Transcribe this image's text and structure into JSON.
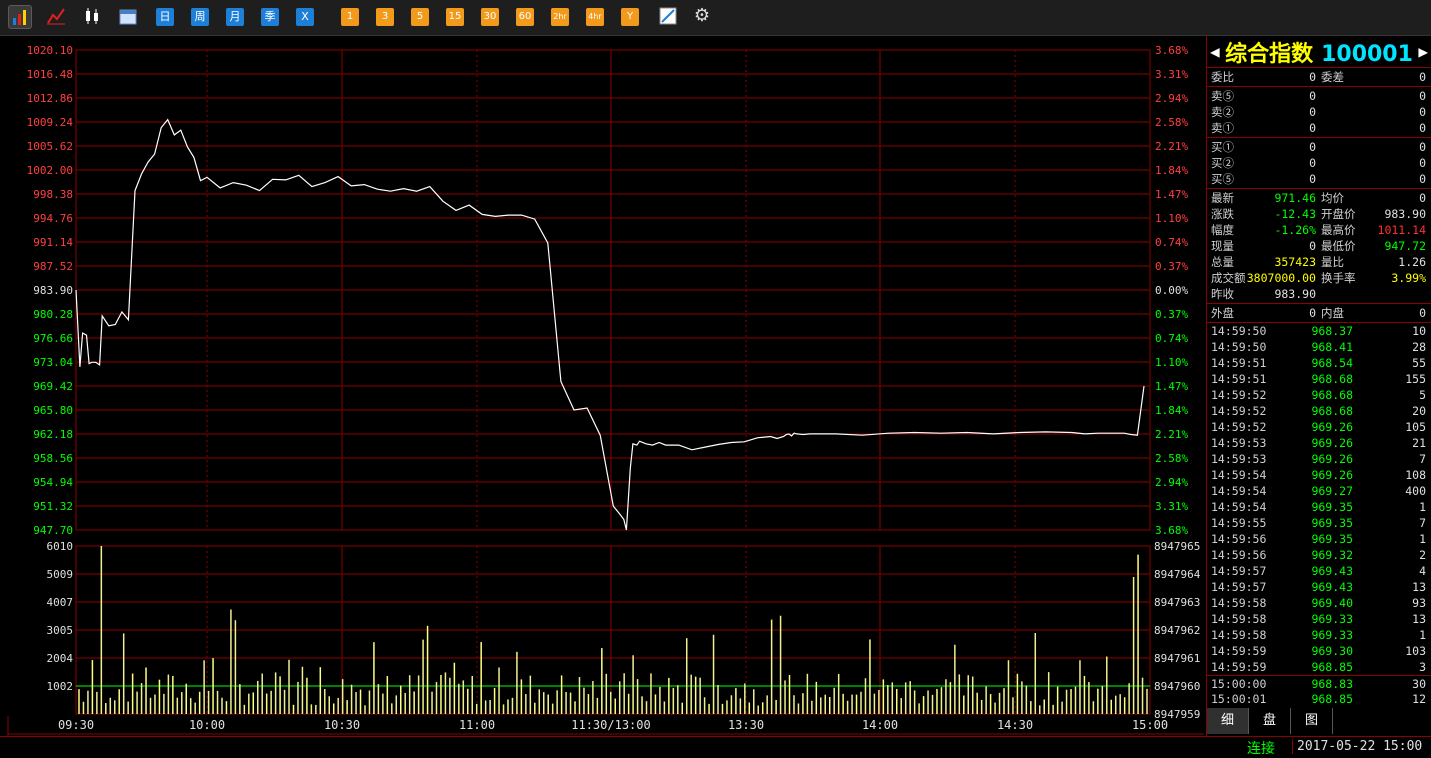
{
  "toolbar": {
    "icon_buttons": [
      "bar-chart-icon",
      "line-chart-icon",
      "candlestick-icon",
      "calendar-icon"
    ],
    "period_buttons": [
      "日",
      "周",
      "月",
      "季",
      "X"
    ],
    "interval_buttons": [
      "1",
      "3",
      "5",
      "15",
      "30",
      "60",
      "2hr",
      "4hr",
      "Y"
    ],
    "tool_icons": [
      "draw-line-icon",
      "gear-icon"
    ]
  },
  "chart_data": {
    "type": "line",
    "title": "",
    "price_ticks": [
      "1020.10",
      "1016.48",
      "1012.86",
      "1009.24",
      "1005.62",
      "1002.00",
      "998.38",
      "994.76",
      "991.14",
      "987.52",
      "983.90",
      "980.28",
      "976.66",
      "973.04",
      "969.42",
      "965.80",
      "962.18",
      "958.56",
      "954.94",
      "951.32",
      "947.70"
    ],
    "pct_ticks": [
      "3.68%",
      "3.31%",
      "2.94%",
      "2.58%",
      "2.21%",
      "1.84%",
      "1.47%",
      "1.10%",
      "0.74%",
      "0.37%",
      "0.00%",
      "0.37%",
      "0.74%",
      "1.10%",
      "1.47%",
      "1.84%",
      "2.21%",
      "2.58%",
      "2.94%",
      "3.31%",
      "3.68%"
    ],
    "ylim": [
      947.7,
      1020.1
    ],
    "prev_close": 983.9,
    "time_labels": [
      "09:30",
      "10:00",
      "10:30",
      "11:00",
      "11:30/13:00",
      "13:30",
      "14:00",
      "14:30",
      "15:00"
    ],
    "price_series": {
      "x": [
        0,
        3,
        5,
        8,
        10,
        12,
        15,
        18,
        20,
        25,
        30,
        35,
        40,
        45,
        50,
        55,
        60,
        65,
        70,
        75,
        80,
        85,
        90,
        95,
        100,
        110,
        120,
        130,
        140,
        150,
        160,
        170,
        180,
        190,
        200,
        210,
        220,
        230,
        240,
        250,
        260,
        270,
        280,
        290,
        300,
        310,
        320,
        330,
        340,
        350,
        360,
        370,
        380,
        390,
        400,
        410,
        415,
        418,
        420,
        423,
        425,
        428,
        430,
        435,
        440,
        445,
        450,
        460,
        470,
        480,
        490,
        500,
        510,
        520,
        530,
        535,
        540,
        542,
        544,
        546,
        548,
        550,
        555,
        560,
        570,
        580,
        600,
        620,
        640,
        660,
        680,
        700,
        720,
        740,
        760,
        770,
        780,
        795,
        800,
        805,
        810,
        815
      ],
      "y": [
        983.9,
        972.3,
        977.4,
        977.1,
        972.8,
        973.0,
        973.0,
        972.6,
        980.0,
        978.5,
        978.7,
        980.6,
        979.4,
        998.9,
        1001.4,
        1003.2,
        1004.4,
        1008.4,
        1009.6,
        1007.3,
        1008.0,
        1005.5,
        1003.9,
        1000.4,
        1000.9,
        999.3,
        1000.1,
        999.7,
        998.9,
        1000.6,
        1000.5,
        1001.2,
        999.5,
        1000.1,
        1001.0,
        999.6,
        999.8,
        999.1,
        998.8,
        999.2,
        998.8,
        999.5,
        997.3,
        995.9,
        996.7,
        995.3,
        995.0,
        995.2,
        995.2,
        994.6,
        991.0,
        970.1,
        965.8,
        966.1,
        962.0,
        951.3,
        950.1,
        949.3,
        947.7,
        957.0,
        960.7,
        960.5,
        961.1,
        960.7,
        960.5,
        960.9,
        960.5,
        960.5,
        959.8,
        960.2,
        960.6,
        960.9,
        961.0,
        961.6,
        961.8,
        961.5,
        961.8,
        962.1,
        962.2,
        961.9,
        962.3,
        962.2,
        962.1,
        962.2,
        962.2,
        962.2,
        962.0,
        962.3,
        962.4,
        962.3,
        962.4,
        962.2,
        962.4,
        962.5,
        962.4,
        962.2,
        962.3,
        962.3,
        962.3,
        962.1,
        962.0,
        969.4,
        970.6
      ]
    },
    "volume_ticks_left": [
      "6010",
      "5009",
      "4007",
      "3005",
      "2004",
      "1002"
    ],
    "volume_ticks_right": [
      "8947965",
      "8947964",
      "8947963",
      "8947962",
      "8947961",
      "8947960",
      "8947959"
    ],
    "volume_max": 6010,
    "volume_seed": 7
  },
  "panel": {
    "title_name": "综合指数",
    "title_code": "100001",
    "rows_top": [
      {
        "l1": "委比",
        "v1": "0",
        "l2": "委差",
        "v2": "0"
      }
    ],
    "sell": [
      {
        "l": "卖⑤",
        "v1": "0",
        "v2": "0"
      },
      {
        "l": "卖②",
        "v1": "0",
        "v2": "0"
      },
      {
        "l": "卖①",
        "v1": "0",
        "v2": "0"
      }
    ],
    "buy": [
      {
        "l": "买①",
        "v1": "0",
        "v2": "0"
      },
      {
        "l": "买②",
        "v1": "0",
        "v2": "0"
      },
      {
        "l": "买⑤",
        "v1": "0",
        "v2": "0"
      }
    ],
    "quote": [
      {
        "l1": "最新",
        "v1": "971.46",
        "c1": "green",
        "l2": "均价",
        "v2": "0",
        "c2": "white"
      },
      {
        "l1": "涨跌",
        "v1": "-12.43",
        "c1": "green",
        "l2": "开盘价",
        "v2": "983.90",
        "c2": "white"
      },
      {
        "l1": "幅度",
        "v1": "-1.26%",
        "c1": "green",
        "l2": "最高价",
        "v2": "1011.14",
        "c2": "red"
      },
      {
        "l1": "现量",
        "v1": "0",
        "c1": "white",
        "l2": "最低价",
        "v2": "947.72",
        "c2": "green"
      },
      {
        "l1": "总量",
        "v1": "357423",
        "c1": "yellow",
        "l2": "量比",
        "v2": "1.26",
        "c2": "white"
      },
      {
        "l1": "成交额",
        "v1": "3807000.00",
        "c1": "yellow",
        "l2": "换手率",
        "v2": "3.99%",
        "c2": "yellow"
      },
      {
        "l1": "昨收",
        "v1": "983.90",
        "c1": "white",
        "l2": "",
        "v2": "",
        "c2": "white"
      }
    ],
    "outer_inner": {
      "l1": "外盘",
      "v1": "0",
      "l2": "内盘",
      "v2": "0"
    },
    "ticks": [
      [
        "14:59:50",
        "968.37",
        "10"
      ],
      [
        "14:59:50",
        "968.41",
        "28"
      ],
      [
        "14:59:51",
        "968.54",
        "55"
      ],
      [
        "14:59:51",
        "968.68",
        "155"
      ],
      [
        "14:59:52",
        "968.68",
        "5"
      ],
      [
        "14:59:52",
        "968.68",
        "20"
      ],
      [
        "14:59:52",
        "969.26",
        "105"
      ],
      [
        "14:59:53",
        "969.26",
        "21"
      ],
      [
        "14:59:53",
        "969.26",
        "7"
      ],
      [
        "14:59:54",
        "969.26",
        "108"
      ],
      [
        "14:59:54",
        "969.27",
        "400"
      ],
      [
        "14:59:54",
        "969.35",
        "1"
      ],
      [
        "14:59:55",
        "969.35",
        "7"
      ],
      [
        "14:59:56",
        "969.35",
        "1"
      ],
      [
        "14:59:56",
        "969.32",
        "2"
      ],
      [
        "14:59:57",
        "969.43",
        "4"
      ],
      [
        "14:59:57",
        "969.43",
        "13"
      ],
      [
        "14:59:58",
        "969.40",
        "93"
      ],
      [
        "14:59:58",
        "969.33",
        "13"
      ],
      [
        "14:59:58",
        "969.33",
        "1"
      ],
      [
        "14:59:59",
        "969.30",
        "103"
      ],
      [
        "14:59:59",
        "968.85",
        "3"
      ],
      [
        "15:00:00",
        "968.83",
        "30"
      ],
      [
        "15:00:01",
        "968.85",
        "12"
      ]
    ],
    "tabs": [
      "细",
      "盘",
      "图"
    ]
  },
  "status": {
    "connection": "连接",
    "datetime": "2017-05-22 15:00"
  }
}
